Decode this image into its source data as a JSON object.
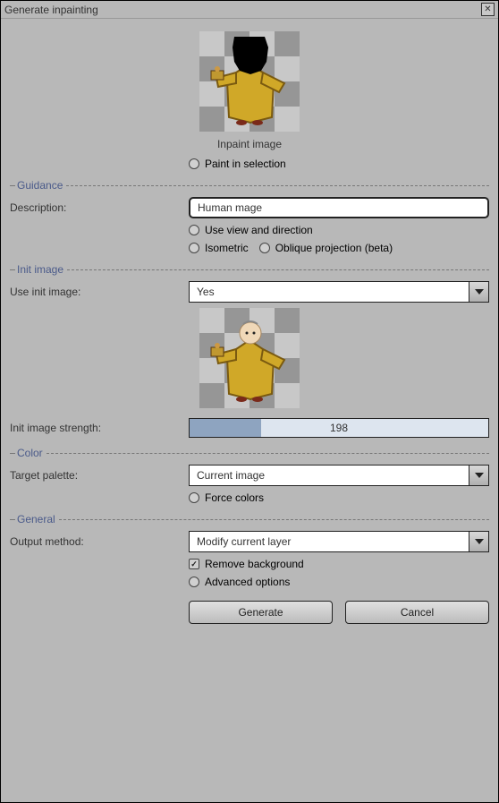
{
  "window": {
    "title": "Generate inpainting"
  },
  "top": {
    "caption": "Inpaint image",
    "paint_in_selection": "Paint in selection"
  },
  "guidance": {
    "legend": "Guidance",
    "description_label": "Description:",
    "description_value": "Human mage",
    "use_view": "Use view and direction",
    "isometric": "Isometric",
    "oblique": "Oblique projection (beta)"
  },
  "init": {
    "legend": "Init image",
    "use_init_label": "Use init image:",
    "use_init_value": "Yes",
    "strength_label": "Init image strength:",
    "strength_value": "198",
    "strength_fill_pct": 24
  },
  "color": {
    "legend": "Color",
    "palette_label": "Target palette:",
    "palette_value": "Current image",
    "force_colors": "Force colors"
  },
  "general": {
    "legend": "General",
    "output_label": "Output method:",
    "output_value": "Modify current layer",
    "remove_bg": "Remove background",
    "advanced": "Advanced options"
  },
  "buttons": {
    "generate": "Generate",
    "cancel": "Cancel"
  }
}
